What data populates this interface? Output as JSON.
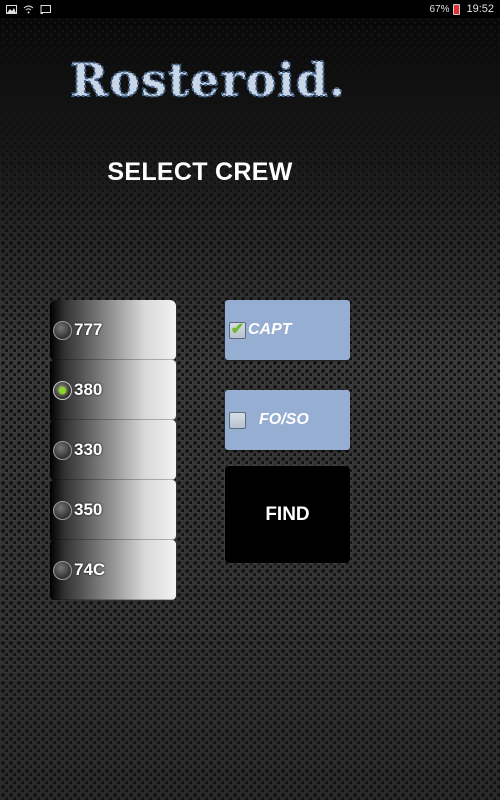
{
  "status_bar": {
    "battery": "67%",
    "time": "19:52"
  },
  "app": {
    "logo_text": "Rosteroid.",
    "title": "SELECT CREW"
  },
  "aircraft": {
    "options": [
      "777",
      "380",
      "330",
      "350",
      "74C"
    ],
    "selected": "380"
  },
  "crew_roles": {
    "capt_label": "CAPT",
    "capt_checked": true,
    "foso_label": "FO/SO",
    "foso_checked": false
  },
  "actions": {
    "find_label": "FIND"
  },
  "colors": {
    "checkbox_bg": "#95aed1",
    "radio_selected": "#8fd42a",
    "logo_fill": "#c9d6e8",
    "logo_outline": "#5b7fa8"
  }
}
